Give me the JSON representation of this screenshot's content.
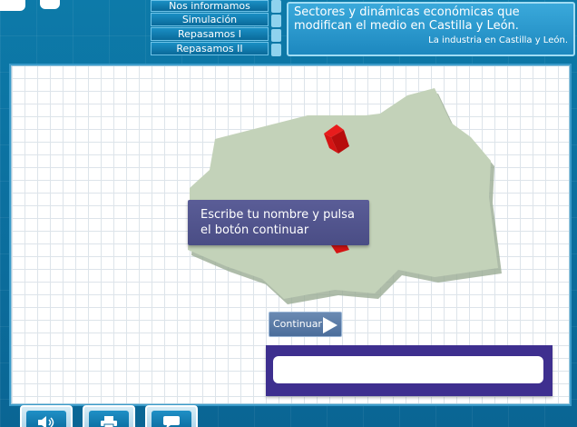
{
  "menu": {
    "items": [
      {
        "label": "Nos informamos"
      },
      {
        "label": "Simulación"
      },
      {
        "label": "Repasamos I"
      },
      {
        "label": "Repasamos II"
      }
    ]
  },
  "header": {
    "title": "Sectores y dinámicas económicas que modifican el medio en Castilla y León.",
    "subtitle": "La industria en Castilla y León."
  },
  "main": {
    "prompt": "Escribe tu nombre y pulsa el botón continuar",
    "continue_label": "Continuar",
    "name_input": {
      "value": "",
      "placeholder": ""
    }
  },
  "toolbar": {
    "icons": [
      "speaker-icon",
      "printer-icon",
      "speech-bubble-icon"
    ]
  },
  "colors": {
    "frame": "#0d7aa9",
    "map_fill": "#c3d2b9",
    "marker": "#e01515",
    "prompt_bg": "#52558e",
    "input_frame": "#3e2f8f"
  }
}
